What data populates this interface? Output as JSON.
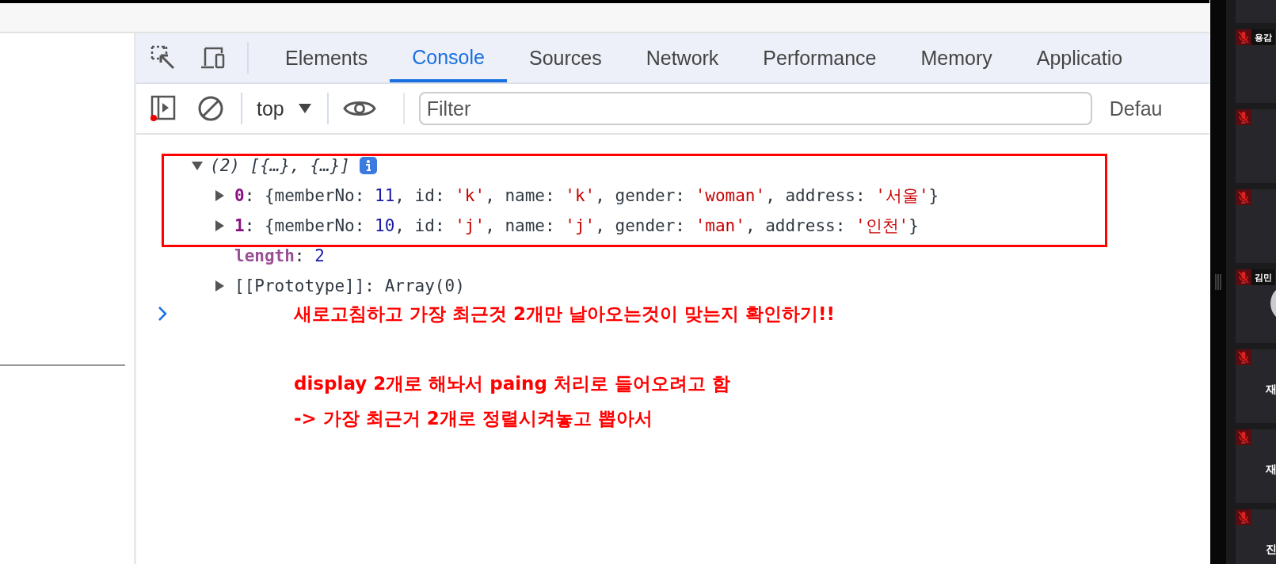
{
  "devtools": {
    "tabs": [
      {
        "label": "Elements",
        "selected": false
      },
      {
        "label": "Console",
        "selected": true
      },
      {
        "label": "Sources",
        "selected": false
      },
      {
        "label": "Network",
        "selected": false
      },
      {
        "label": "Performance",
        "selected": false
      },
      {
        "label": "Memory",
        "selected": false
      },
      {
        "label": "Applicatio",
        "selected": false
      }
    ],
    "console_toolbar": {
      "sidebar_alert": true,
      "context": "top",
      "filter_placeholder": "Filter",
      "level_menu": "Defau"
    },
    "output": {
      "summary": "(2) [{…}, {…}]",
      "expanded": true,
      "rows": [
        {
          "expanded": false,
          "parts": [
            {
              "text": "0",
              "kind": "index"
            },
            {
              "text": ": {memberNo: ",
              "kind": "plain"
            },
            {
              "text": "11",
              "kind": "number"
            },
            {
              "text": ", id: ",
              "kind": "plain"
            },
            {
              "text": "'k'",
              "kind": "string"
            },
            {
              "text": ", name: ",
              "kind": "plain"
            },
            {
              "text": "'k'",
              "kind": "string"
            },
            {
              "text": ", gender: ",
              "kind": "plain"
            },
            {
              "text": "'woman'",
              "kind": "string"
            },
            {
              "text": ", address: ",
              "kind": "plain"
            },
            {
              "text": "'서울'",
              "kind": "string"
            },
            {
              "text": "}",
              "kind": "plain"
            }
          ]
        },
        {
          "expanded": false,
          "parts": [
            {
              "text": "1",
              "kind": "index"
            },
            {
              "text": ": {memberNo: ",
              "kind": "plain"
            },
            {
              "text": "10",
              "kind": "number"
            },
            {
              "text": ", id: ",
              "kind": "plain"
            },
            {
              "text": "'j'",
              "kind": "string"
            },
            {
              "text": ", name: ",
              "kind": "plain"
            },
            {
              "text": "'j'",
              "kind": "string"
            },
            {
              "text": ", gender: ",
              "kind": "plain"
            },
            {
              "text": "'man'",
              "kind": "string"
            },
            {
              "text": ", address: ",
              "kind": "plain"
            },
            {
              "text": "'인천'",
              "kind": "string"
            },
            {
              "text": "}",
              "kind": "plain"
            }
          ]
        },
        {
          "parts": [
            {
              "text": "length",
              "kind": "hidden-key"
            },
            {
              "text": ": ",
              "kind": "plain"
            },
            {
              "text": "2",
              "kind": "number"
            }
          ]
        },
        {
          "expanded": false,
          "parts": [
            {
              "text": "[[Prototype]]: Array(0)",
              "kind": "plain"
            }
          ]
        }
      ]
    },
    "highlight_box": true,
    "notes": [
      [
        "새로고침하고 가장 최근것 2개만 날아오는것이 맞는지 확인하기!!"
      ],
      [
        "display 2개로 해놔서 paing 처리로 들어오려고 함",
        "-> 가장 최근거 2개로 정렬시켜놓고 뽑아서"
      ]
    ]
  },
  "meeting_panel": {
    "tiles": [
      {
        "kind": "partial"
      },
      {
        "muted": true,
        "name_tag": "용감"
      },
      {
        "muted": true
      },
      {
        "muted": true
      },
      {
        "muted": true,
        "name_tag": "김민",
        "avatar": true
      },
      {
        "muted": true,
        "caption": "재"
      },
      {
        "muted": true,
        "caption": "재"
      },
      {
        "muted": true,
        "caption": "진"
      }
    ]
  }
}
